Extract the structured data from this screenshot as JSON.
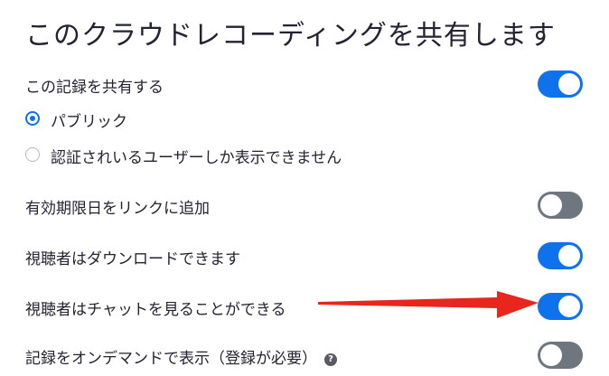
{
  "title": "このクラウドレコーディングを共有します",
  "share": {
    "label": "この記録を共有する",
    "enabled": true
  },
  "visibility": {
    "options": [
      {
        "label": "パブリック",
        "selected": true
      },
      {
        "label": "認証されいるユーザーしか表示できません",
        "selected": false
      }
    ]
  },
  "settings": [
    {
      "label": "有効期限日をリンクに追加",
      "enabled": false
    },
    {
      "label": "視聴者はダウンロードできます",
      "enabled": true
    },
    {
      "label": "視聴者はチャットを見ることができる",
      "enabled": true
    },
    {
      "label": "記録をオンデマンドで表示（登録が必要）",
      "enabled": false,
      "help_icon": "question-circle-icon"
    }
  ],
  "colors": {
    "accent": "#0e72ed",
    "toggle_off": "#6e7680",
    "annotation_arrow": "#e8261e"
  },
  "annotation": {
    "type": "arrow",
    "points_to": "視聴者はチャットを見ることができる"
  }
}
